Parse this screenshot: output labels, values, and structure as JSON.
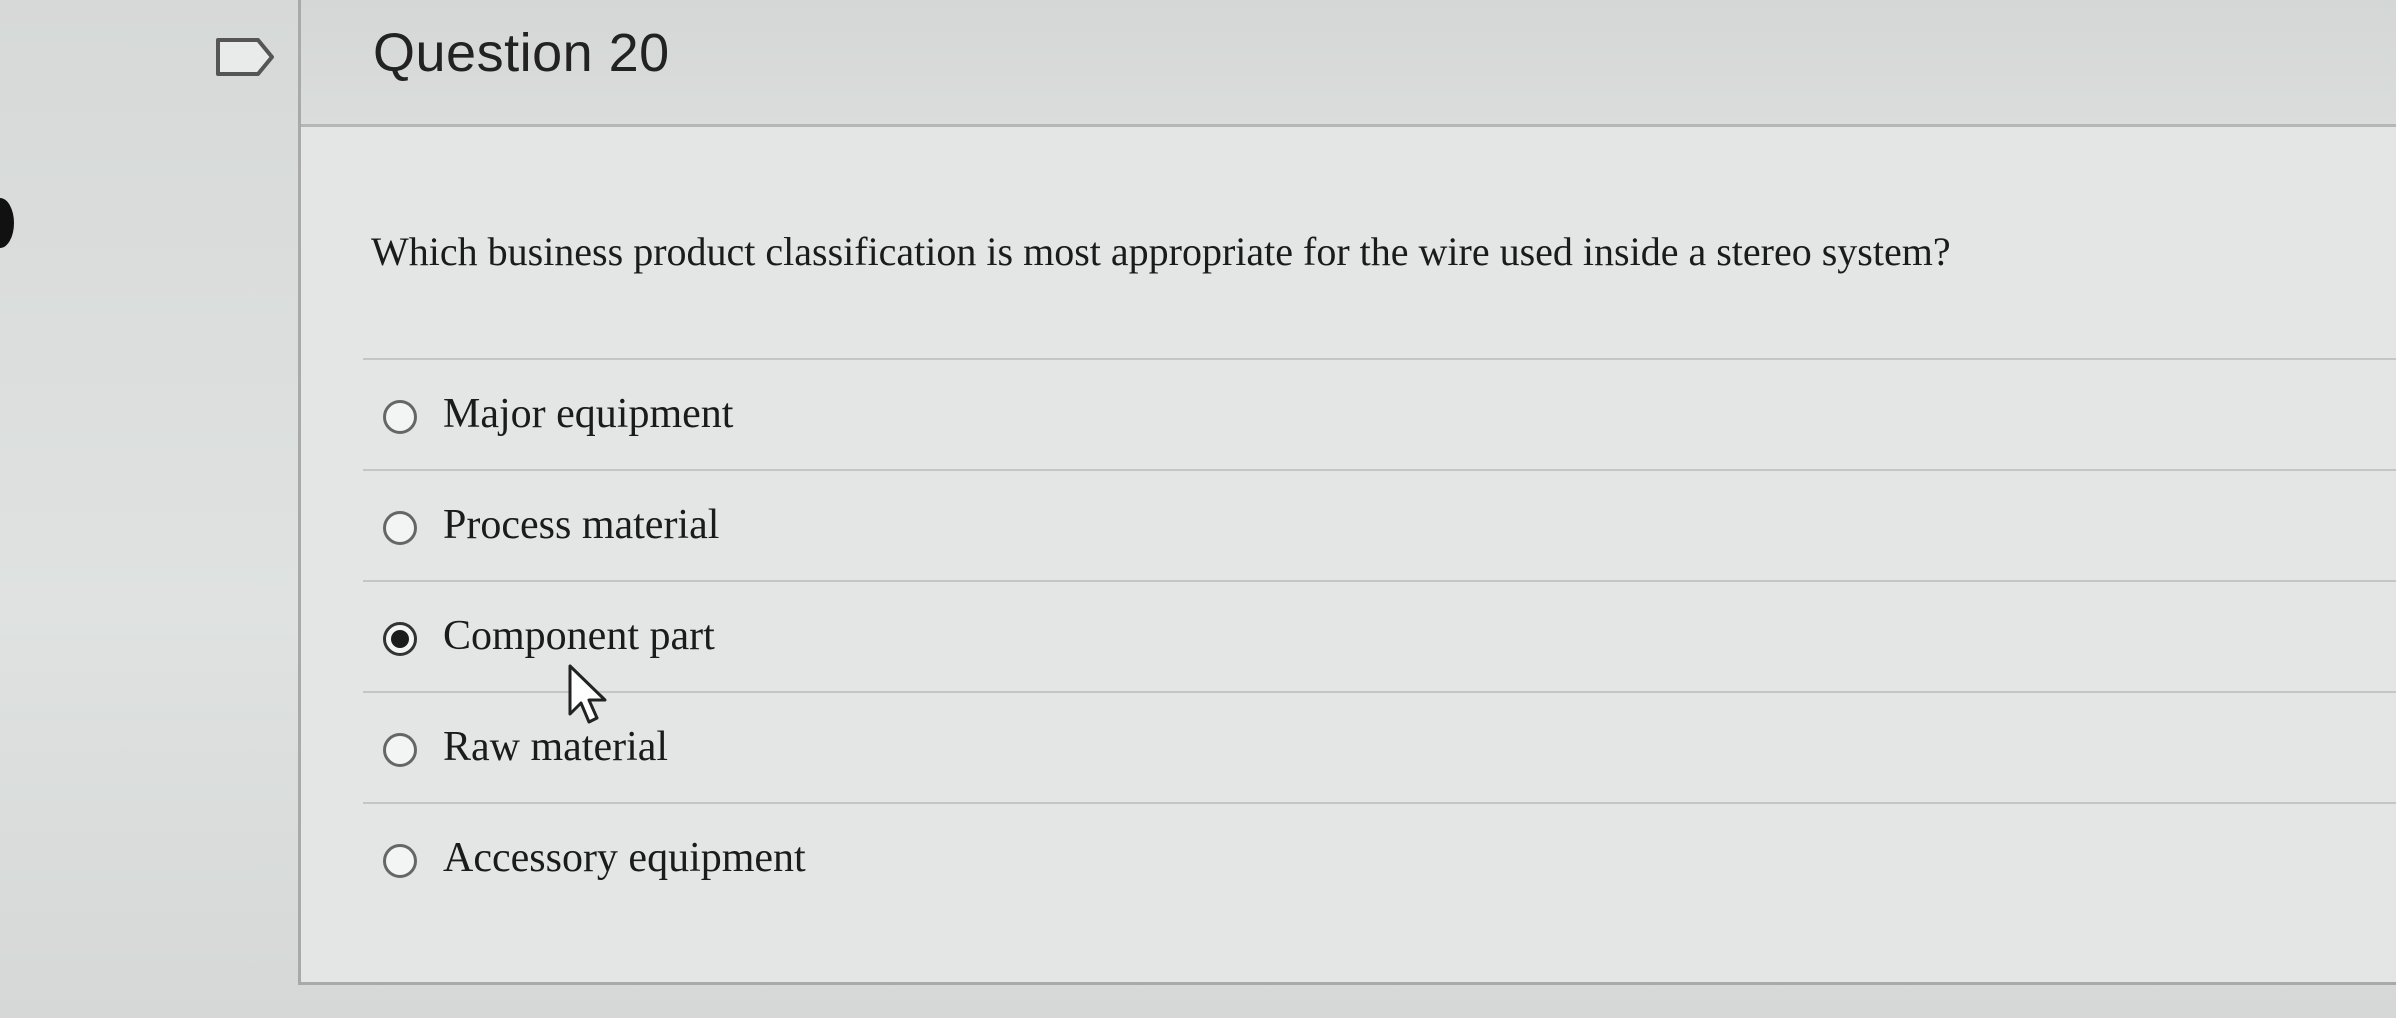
{
  "question": {
    "title": "Question 20",
    "prompt": "Which business product classification is most appropriate for the wire used inside a stereo system?",
    "selected_index": 2,
    "options": [
      {
        "label": "Major equipment",
        "selected": false
      },
      {
        "label": "Process material",
        "selected": false
      },
      {
        "label": "Component part",
        "selected": true
      },
      {
        "label": "Raw material",
        "selected": false
      },
      {
        "label": "Accessory equipment",
        "selected": false
      }
    ]
  },
  "icons": {
    "flag": "flag-icon",
    "cursor": "mouse-pointer-icon"
  }
}
